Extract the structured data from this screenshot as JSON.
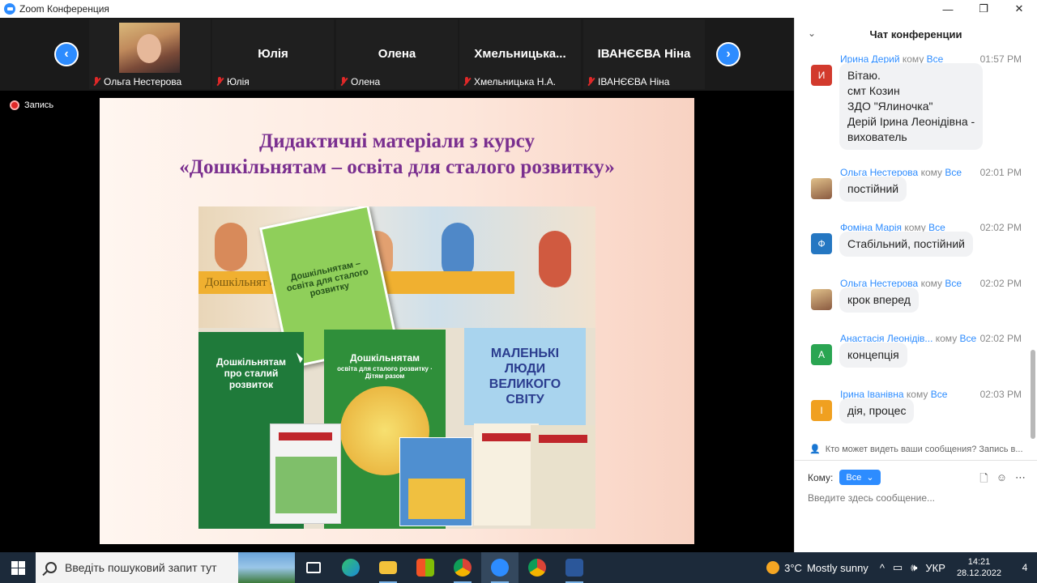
{
  "window": {
    "title": "Zoom Конференция",
    "minimize": "—",
    "restore": "❐",
    "close": "✕"
  },
  "gallery": {
    "prev": "‹",
    "next": "›",
    "tiles": [
      {
        "name": "",
        "label": "Ольга Нестерова",
        "has_photo": true
      },
      {
        "name": "Юлія",
        "label": "Юлія"
      },
      {
        "name": "Олена",
        "label": "Олена"
      },
      {
        "name": "Хмельницька...",
        "label": "Хмельницька Н.А."
      },
      {
        "name": "ІВАНЄЄВА Ніна",
        "label": "ІВАНЄЄВА Ніна"
      }
    ]
  },
  "recording": {
    "label": "Запись"
  },
  "slide": {
    "title_line1": "Дидактичні матеріали з курсу",
    "title_line2": "«Дошкільнятам – освіта для сталого розвитку»",
    "banner": "Дошкільнят                     сталого розвитку",
    "book1": "Дошкільнятам – освіта для сталого розвитку",
    "book2": "Дошкільнятам про сталий розвиток",
    "book3": "Дошкільнятам",
    "book3_sub": "освіта для сталого розвитку · Дітям разом",
    "book4": "МАЛЕНЬКІ ЛЮДИ ВЕЛИКОГО СВІТУ"
  },
  "chat": {
    "title": "Чат конференции",
    "to_word": "кому",
    "messages": [
      {
        "sender": "Ирина Дерий",
        "to": "Все",
        "time": "01:57 PM",
        "avatar": "И",
        "color": "#d23a2d",
        "lines": [
          "Вітаю.",
          "смт Козин",
          "ЗДО \"Ялиночка\"",
          "Дерій Ірина Леонідівна -",
          "вихователь"
        ]
      },
      {
        "sender": "Ольга Нестерова",
        "to": "Все",
        "time": "02:01 PM",
        "avatar": "",
        "color": "#c9a26a",
        "lines": [
          "постійний"
        ]
      },
      {
        "sender": "Фоміна Марія",
        "to": "Все",
        "time": "02:02 PM",
        "avatar": "Ф",
        "color": "#2577c2",
        "lines": [
          "Стабільний, постійний"
        ]
      },
      {
        "sender": "Ольга Нестерова",
        "to": "Все",
        "time": "02:02 PM",
        "avatar": "",
        "color": "#c9a26a",
        "lines": [
          "крок вперед"
        ]
      },
      {
        "sender": "Анастасія Леонідів...",
        "to": "Все",
        "time": "02:02 PM",
        "avatar": "А",
        "color": "#2aa552",
        "lines": [
          "концепція"
        ]
      },
      {
        "sender": "Ірина Іванівна",
        "to": "Все",
        "time": "02:03 PM",
        "avatar": "І",
        "color": "#f0a020",
        "lines": [
          "дія, процес"
        ]
      }
    ],
    "who_sees": "Кто может видеть ваши сообщения? Запись в...",
    "to_label": "Кому:",
    "to_value": "Все",
    "input_placeholder": "Введите здесь сообщение..."
  },
  "taskbar": {
    "search_placeholder": "Введіть пошуковий запит тут",
    "weather_temp": "3°C",
    "weather_text": "Mostly sunny",
    "lang": "УКР",
    "time": "14:21",
    "date": "28.12.2022",
    "notifications": "4",
    "apps": [
      "task-view",
      "edge",
      "file-explorer",
      "store",
      "chrome-profile",
      "zoom",
      "chrome",
      "word"
    ]
  }
}
